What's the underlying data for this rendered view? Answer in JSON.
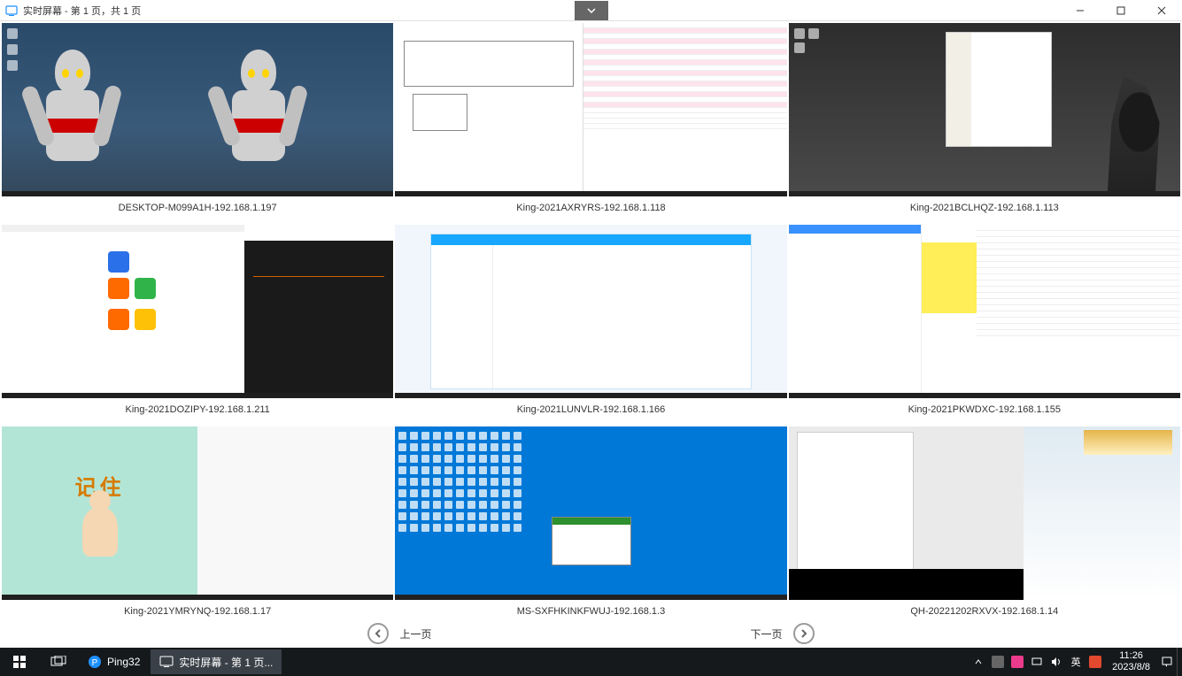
{
  "window": {
    "title": "实时屏幕 - 第 1 页，共 1 页",
    "collapse_icon": "chevron-down"
  },
  "screens": [
    {
      "label": "DESKTOP-M099A1H-192.168.1.197",
      "thumb_kind": "ultraman-desktop"
    },
    {
      "label": "King-2021AXRYRS-192.168.1.118",
      "thumb_kind": "cad-spreadsheet"
    },
    {
      "label": "King-2021BCLHQZ-192.168.1.113",
      "thumb_kind": "dark-desktop-explorer"
    },
    {
      "label": "King-2021DOZIPY-192.168.1.211",
      "thumb_kind": "browser-cad"
    },
    {
      "label": "King-2021LUNVLR-192.168.1.166",
      "thumb_kind": "qq-chat"
    },
    {
      "label": "King-2021PKWDXC-192.168.1.155",
      "thumb_kind": "ecom-sheet"
    },
    {
      "label": "King-2021YMRYNQ-192.168.1.17",
      "thumb_kind": "monk-editor"
    },
    {
      "label": "MS-SXFHKINKFWUJ-192.168.1.3",
      "thumb_kind": "win10-blue-desktop"
    },
    {
      "label": "QH-20221202RXVX-192.168.1.14",
      "thumb_kind": "doc-mixed"
    }
  ],
  "thumb_text": {
    "t7_heading": "记住"
  },
  "pager": {
    "prev": "上一页",
    "next": "下一页"
  },
  "taskbar": {
    "apps": [
      {
        "name": "Ping32",
        "icon": "ping32"
      },
      {
        "name": "实时屏幕 - 第 1 页...",
        "icon": "realtime",
        "active": true
      }
    ],
    "ime": "英",
    "time": "11:26",
    "date": "2023/8/8"
  }
}
